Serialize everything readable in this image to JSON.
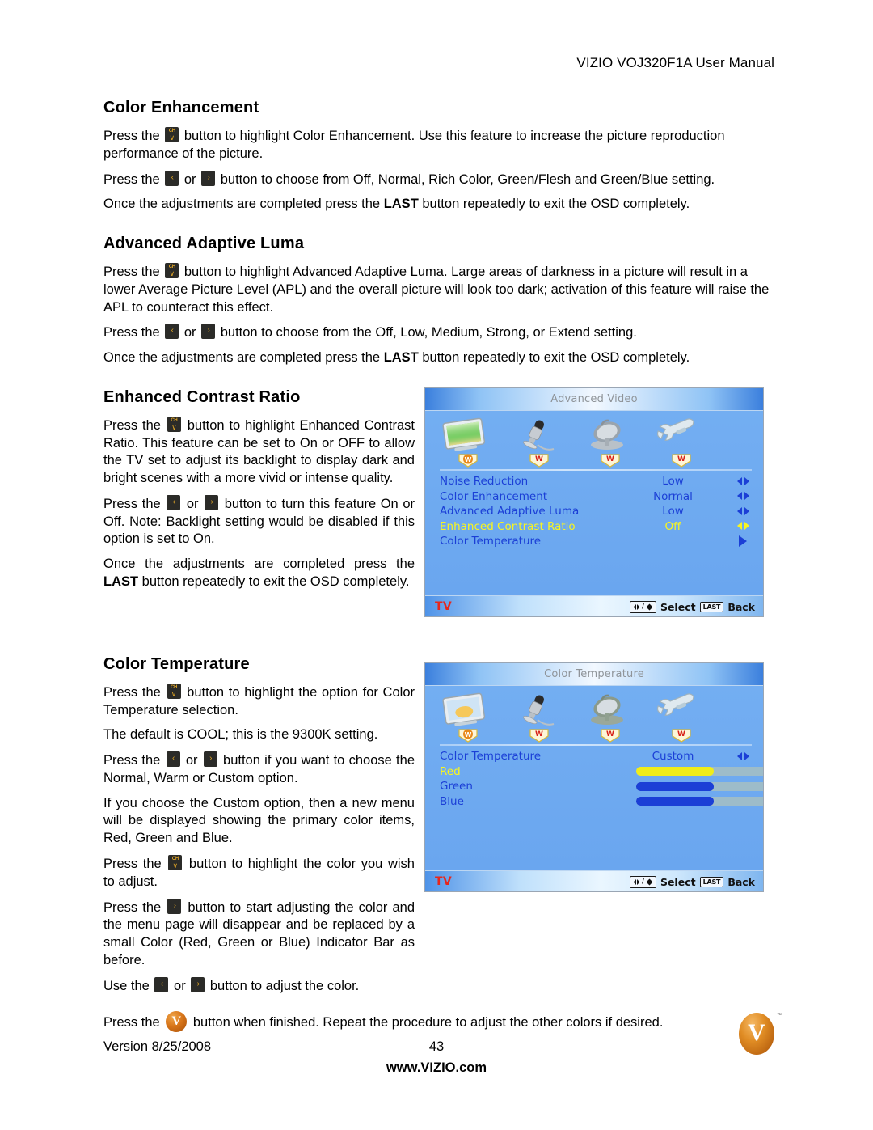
{
  "header": {
    "title": "VIZIO VOJ320F1A User Manual"
  },
  "sections": [
    {
      "title": "Color Enhancement",
      "paragraphs": [
        {
          "pre": "Press the ",
          "icon": "ch-down-button-icon",
          "post": " button to highlight Color Enhancement.  Use this feature to increase the picture reproduction performance of the picture."
        },
        {
          "pre": "Press the ",
          "icon": "left-right-buttons-icon",
          "mid": " or ",
          "post": " button to choose from Off, Normal, Rich Color, Green/Flesh and Green/Blue setting."
        },
        {
          "plain_a": "Once the adjustments are completed press the ",
          "bold": "LAST",
          "plain_b": " button repeatedly to exit the OSD completely."
        }
      ]
    },
    {
      "title": "Advanced Adaptive Luma",
      "paragraphs": [
        {
          "pre": "Press the ",
          "post": " button to highlight Advanced Adaptive Luma. Large areas of darkness in a picture will result in a lower Average Picture Level (APL) and the overall picture will look too dark; activation of this feature will raise the APL to counteract this effect."
        },
        {
          "pre": "Press the ",
          "mid": " or ",
          "post": " button to choose from the Off, Low, Medium, Strong, or Extend setting."
        },
        {
          "plain_a": "Once the adjustments are completed press the ",
          "bold": "LAST",
          "plain_b": " button repeatedly to exit the OSD completely."
        }
      ]
    },
    {
      "title": "Enhanced Contrast Ratio",
      "paragraphs": [
        {
          "pre": "Press the ",
          "post": " button to highlight Enhanced Contrast Ratio.  This feature can be set to On or OFF to allow the TV set to adjust its backlight to display dark and bright scenes with a more vivid or intense quality."
        },
        {
          "pre": "Press the ",
          "mid": " or ",
          "post": " button to turn this feature On or Off. Note: Backlight setting would be disabled if this option is set to On."
        },
        {
          "plain_a": "Once the adjustments are completed press the ",
          "bold": "LAST",
          "plain_b": " button repeatedly to exit the OSD completely."
        }
      ]
    },
    {
      "title": "Color Temperature",
      "paragraphs": [
        {
          "pre": "Press the ",
          "post": " button to highlight the option for Color Temperature selection."
        },
        {
          "plain": "The default is COOL; this is the 9300K setting."
        },
        {
          "pre": "Press the ",
          "mid": " or ",
          "post": " button if you want to choose the Normal, Warm or Custom option."
        },
        {
          "plain": "If you choose the Custom option, then a new menu will be displayed showing the primary color items, Red, Green and Blue."
        },
        {
          "pre": "Press the ",
          "post": " button to highlight the color you wish to adjust."
        },
        {
          "pre": "Press the ",
          "post": " button to start adjusting the color and the menu page will disappear and be replaced by a small Color (Red, Green or Blue) Indicator Bar as before."
        },
        {
          "pre": "Use the ",
          "mid": " or ",
          "post": " button to adjust the color."
        },
        {
          "pre": "Press the ",
          "post": " button when finished.  Repeat the procedure to adjust the other colors if desired."
        }
      ]
    }
  ],
  "button_glyphs": {
    "ch_label": "CH",
    "ch_chevron": "∨",
    "left_chevron": "‹",
    "left_bar": "§",
    "right_bar": "§",
    "right_chevron": "›",
    "vizio_letter": "V"
  },
  "osd_advanced_video": {
    "title": "Advanced Video",
    "icons": [
      "picture-screen-icon",
      "microphone-icon",
      "satellite-dish-icon",
      "wrench-icon"
    ],
    "rows": [
      {
        "label": "Noise Reduction",
        "value": "Low",
        "arrow": "left-right",
        "highlighted": false
      },
      {
        "label": "Color Enhancement",
        "value": "Normal",
        "arrow": "left-right",
        "highlighted": false
      },
      {
        "label": "Advanced Adaptive Luma",
        "value": "Low",
        "arrow": "left-right",
        "highlighted": false
      },
      {
        "label": "Enhanced Contrast Ratio",
        "value": "Off",
        "arrow": "left-right",
        "highlighted": true
      },
      {
        "label": "Color Temperature",
        "value": "",
        "arrow": "right",
        "highlighted": false
      }
    ],
    "footer": {
      "source": "TV",
      "select_label": "Select",
      "back_key": "LAST",
      "back_label": "Back"
    },
    "colors": {
      "label": "#1b3fd6",
      "highlight": "#f8f51f",
      "background": "#6aa8f0",
      "source": "#e8261c"
    }
  },
  "osd_color_temperature": {
    "title": "Color Temperature",
    "icons": [
      "picture-screen-icon",
      "microphone-icon",
      "satellite-dish-icon",
      "wrench-icon"
    ],
    "rows": [
      {
        "label": "Color Temperature",
        "value": "Custom",
        "arrow": "left-right",
        "highlighted": false
      }
    ],
    "sliders": [
      {
        "label": "Red",
        "value": "128",
        "percent": 52,
        "fill_color": "#f0ed1a",
        "highlighted": true
      },
      {
        "label": "Green",
        "value": "128",
        "percent": 52,
        "fill_color": "#1b3fd6",
        "highlighted": false
      },
      {
        "label": "Blue",
        "value": "128",
        "percent": 52,
        "fill_color": "#1b3fd6",
        "highlighted": false
      }
    ],
    "footer": {
      "source": "TV",
      "select_label": "Select",
      "back_key": "LAST",
      "back_label": "Back"
    }
  },
  "footer": {
    "version": "Version 8/25/2008",
    "page_number": "43",
    "website": "www.VIZIO.com",
    "logo_letter": "V",
    "trademark": "™"
  }
}
